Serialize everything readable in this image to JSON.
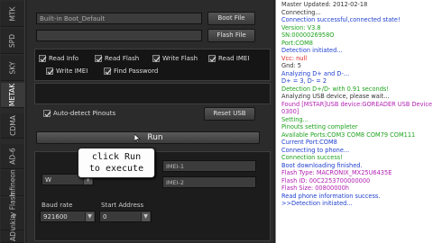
{
  "colors": {
    "log_default": "#333333",
    "log_blue": "#1f3fcf",
    "log_green": "#1ea21e",
    "log_magenta": "#b21fb2",
    "log_red": "#dd2222",
    "panel_bg": "#2b2b2b",
    "tooltip_bg": "#fdfdfd"
  },
  "sidebar_tabs": [
    "Infineon",
    "AD-6",
    "CDMA",
    "METAK",
    "SKY",
    "SPD",
    "MTK"
  ],
  "sidebar_tabs_bottom": [
    "Easy Flash",
    "Ankia",
    "AD"
  ],
  "boot": {
    "field_value": "Built-in Boot_Default",
    "boot_file_label": "Boot File",
    "flash_file_label": "Flash File"
  },
  "options": {
    "read_info": "Read Info",
    "read_flash": "Read Flash",
    "write_flash": "Write Flash",
    "read_imei": "Read IMEI",
    "write_imei": "Write IMEI",
    "find_password": "Find Password"
  },
  "auto_detect_label": "Auto-detect Pinouts",
  "reset_usb_label": "Reset USB",
  "run_label": "Run",
  "tooltip": {
    "line1": "click Run",
    "line2": "to execute"
  },
  "imei": {
    "imei1_label": "IMEI-1",
    "imei2_label": "IMEI-2"
  },
  "baud": {
    "label": "Baud rate",
    "value": "921600"
  },
  "start_address": {
    "label": "Start Address",
    "value": "0"
  },
  "small_select_value": "W",
  "log_lines": [
    {
      "text": "Master Updated: 2012-02-18",
      "color": "#333333"
    },
    {
      "text": "Connecting...",
      "color": "#333333"
    },
    {
      "text": "Connection successful,connected state!",
      "color": "#1f3fcf"
    },
    {
      "text": "Version: V3.8",
      "color": "#1ea21e"
    },
    {
      "text": "SN:0000026958O",
      "color": "#1ea21e"
    },
    {
      "text": "Port:COM8",
      "color": "#1ea21e"
    },
    {
      "text": "Detection initiated...",
      "color": "#1f3fcf"
    },
    {
      "text": "Vcc: null",
      "color": "#dd2222"
    },
    {
      "text": "Gnd: 5",
      "color": "#333333"
    },
    {
      "text": "Analyzing D+ and D-...",
      "color": "#1f3fcf"
    },
    {
      "text": "D+ = 3, D- = 2",
      "color": "#1f3fcf"
    },
    {
      "text": "Detection D+/D- with 0.91 seconds!",
      "color": "#1ea21e"
    },
    {
      "text": "Analyzing USB device, please wait...",
      "color": "#333333"
    },
    {
      "text": "Found [MSTAR]USB device:GOREADER USB Device",
      "color": "#b21fb2"
    },
    {
      "text": "0300]",
      "color": "#b21fb2"
    },
    {
      "text": "Setting...",
      "color": "#1ea21e"
    },
    {
      "text": "Pinouts setting completer",
      "color": "#1ea21e"
    },
    {
      "text": "Available Ports:COM3 COM8 COM79 COM111",
      "color": "#1ea21e"
    },
    {
      "text": "Current Port:COM8",
      "color": "#1f3fcf"
    },
    {
      "text": "Connecting to phone...",
      "color": "#1f3fcf"
    },
    {
      "text": "Connection success!",
      "color": "#1ea21e"
    },
    {
      "text": "Boot downloading finished.",
      "color": "#1f3fcf"
    },
    {
      "text": "Flash Type: MACRONIX_MX25U6435E",
      "color": "#b21fb2"
    },
    {
      "text": "Flash ID:    00C2253700000000",
      "color": "#b21fb2"
    },
    {
      "text": "Flash Size:  00800000h",
      "color": "#b21fb2"
    },
    {
      "text": "Read phone information success.",
      "color": "#1f3fcf"
    },
    {
      "text": ">>Detection initiated...",
      "color": "#1f3fcf"
    }
  ]
}
